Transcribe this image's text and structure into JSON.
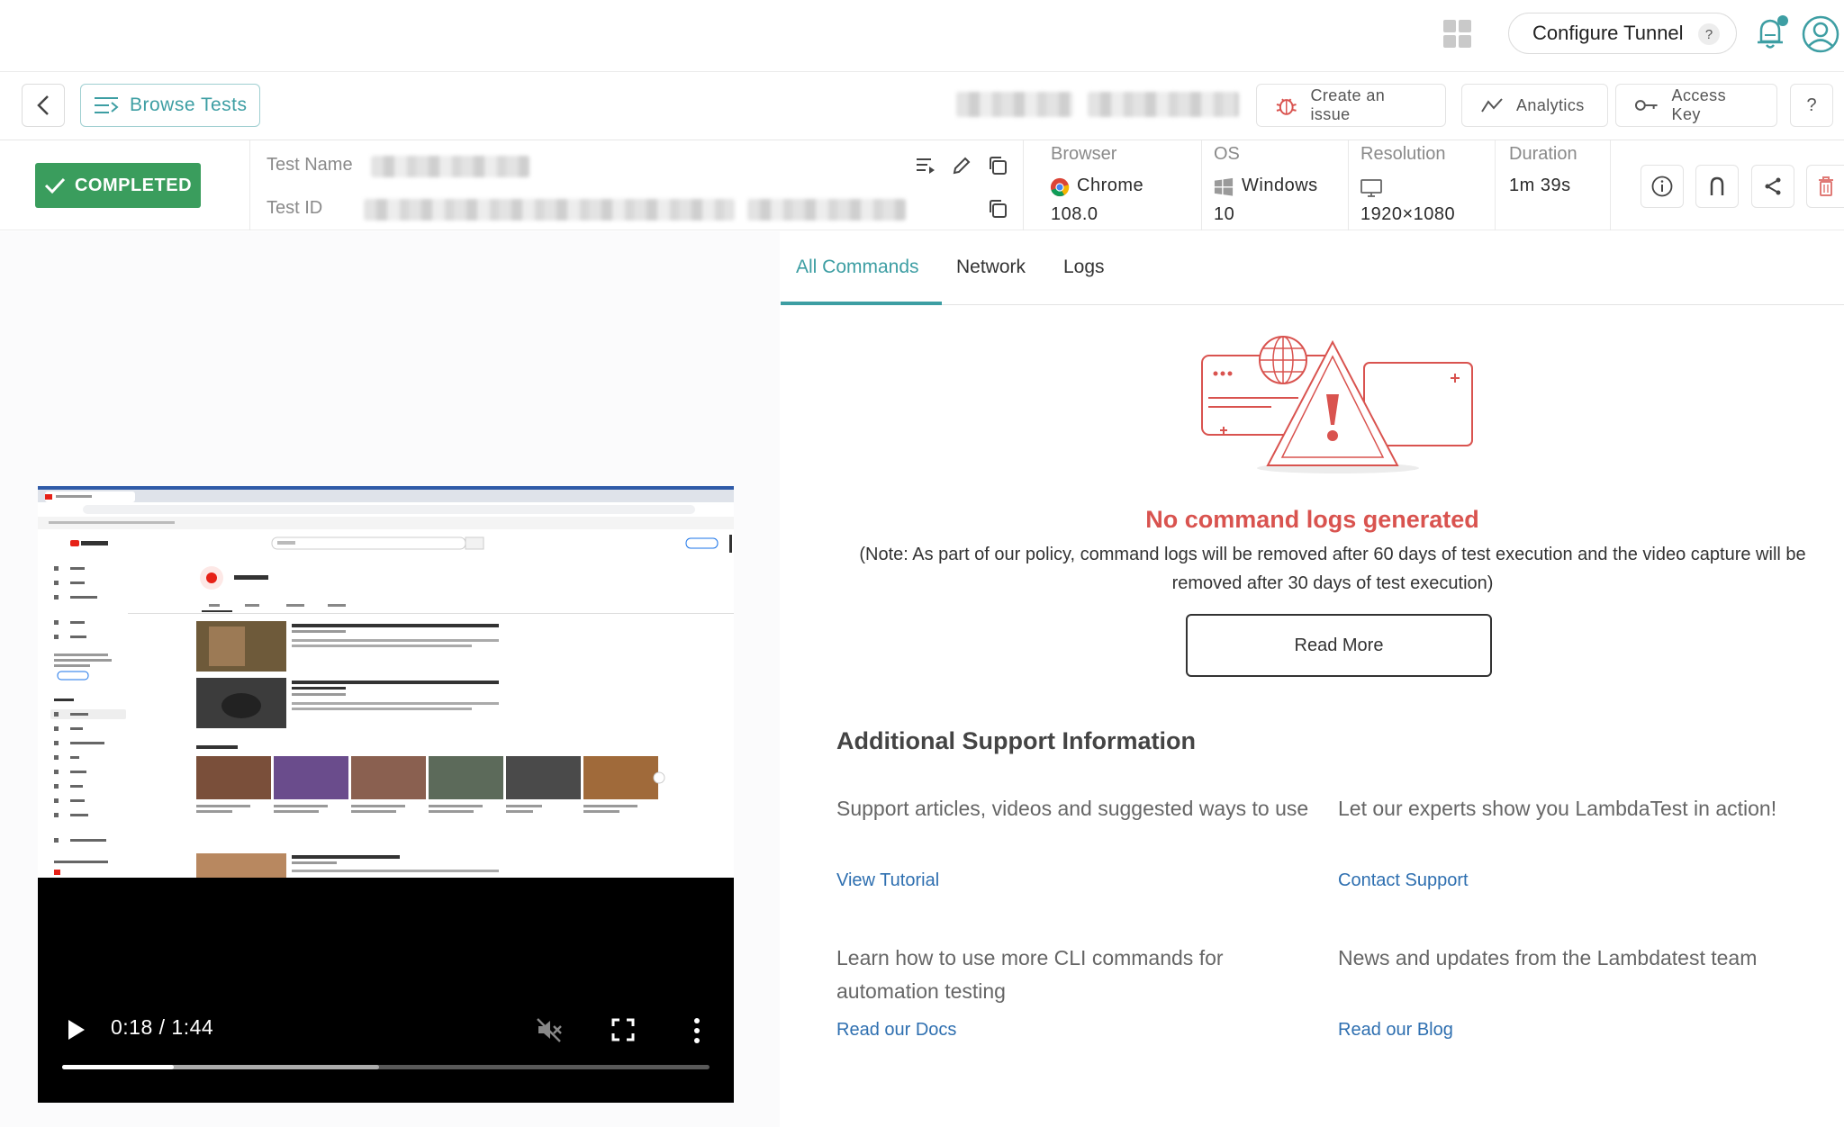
{
  "header": {
    "configure_tunnel": "Configure Tunnel",
    "help_q": "?"
  },
  "toolbar": {
    "browse_tests": "Browse Tests",
    "create_issue": "Create an issue",
    "analytics": "Analytics",
    "access_key": "Access Key",
    "help": "?"
  },
  "test_info": {
    "status": "COMPLETED",
    "test_name_label": "Test Name",
    "test_id_label": "Test ID",
    "browser_label": "Browser",
    "browser_name": "Chrome",
    "browser_version": "108.0",
    "os_label": "OS",
    "os_name": "Windows",
    "os_version": "10",
    "resolution_label": "Resolution",
    "resolution": "1920×1080",
    "duration_label": "Duration",
    "duration": "1m 39s"
  },
  "video": {
    "time": "0:18 / 1:44",
    "played_fraction": 0.173,
    "buffered_fraction": 0.49
  },
  "tabs": [
    "All Commands",
    "Network",
    "Logs"
  ],
  "empty_state": {
    "title": "No command logs generated",
    "note": "(Note: As part of our policy, command logs will be removed after 60 days of test execution and the video capture will be removed after 30 days of test execution)",
    "button": "Read More"
  },
  "support": {
    "title": "Additional Support Information",
    "items": [
      {
        "desc": "Support articles, videos and suggested ways to use",
        "link": "View Tutorial"
      },
      {
        "desc": "Let our experts show you LambdaTest in action!",
        "link": "Contact Support"
      },
      {
        "desc": "Learn how to use more CLI commands for automation testing",
        "link": "Read our Docs"
      },
      {
        "desc": "News and updates from the Lambdatest team",
        "link": "Read our Blog"
      }
    ]
  },
  "colors": {
    "accent": "#3d9ea3",
    "success": "#3a9d5d",
    "error": "#d9534f",
    "link": "#2e6fb0"
  }
}
